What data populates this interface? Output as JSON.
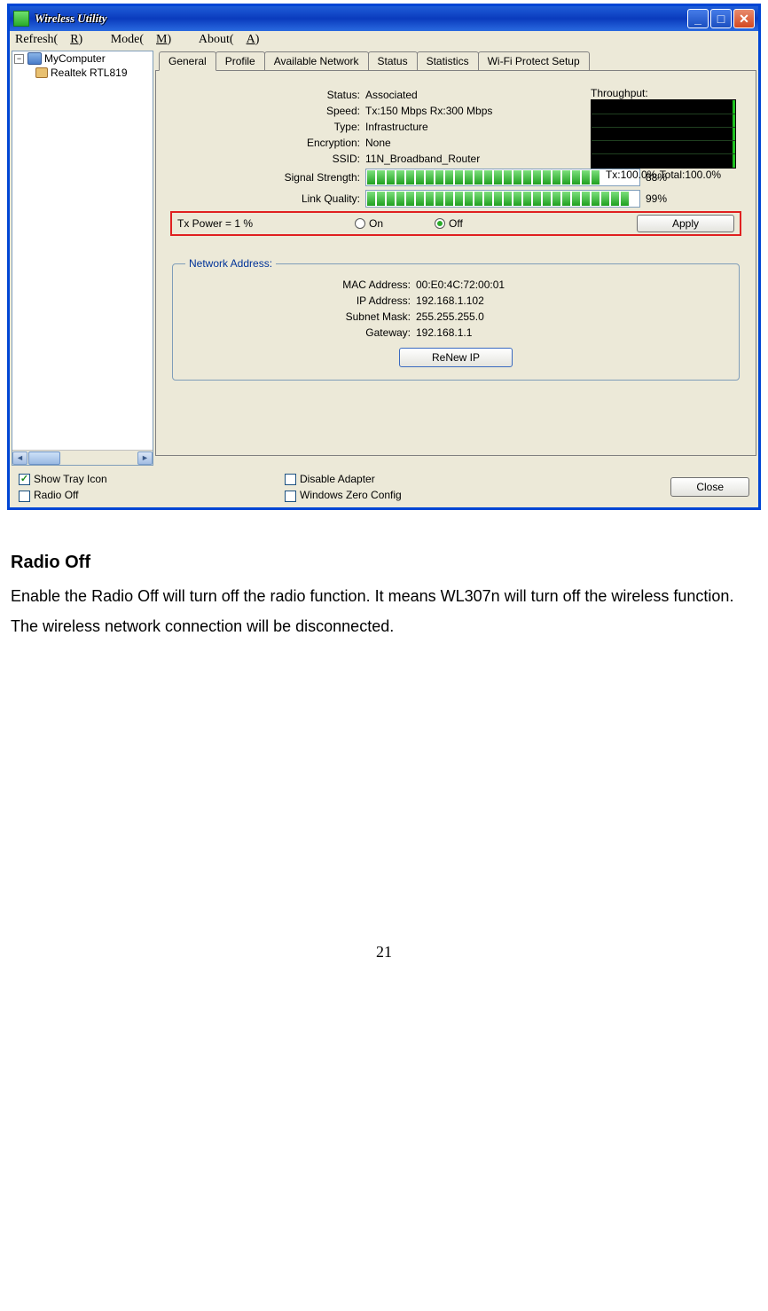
{
  "window": {
    "title": "Wireless Utility"
  },
  "menu": {
    "refresh": "Refresh(",
    "refresh_u": "R",
    "refresh_tail": ")",
    "mode": "Mode(",
    "mode_u": "M",
    "mode_tail": ")",
    "about": "About(",
    "about_u": "A",
    "about_tail": ")"
  },
  "tree": {
    "root": "MyComputer",
    "child": "Realtek RTL819"
  },
  "tabs": [
    "General",
    "Profile",
    "Available Network",
    "Status",
    "Statistics",
    "Wi-Fi Protect Setup"
  ],
  "general": {
    "status_label": "Status:",
    "status": "Associated",
    "speed_label": "Speed:",
    "speed": "Tx:150 Mbps Rx:300 Mbps",
    "type_label": "Type:",
    "type": "Infrastructure",
    "encryption_label": "Encryption:",
    "encryption": "None",
    "ssid_label": "SSID:",
    "ssid": "11N_Broadband_Router",
    "signal_label": "Signal Strength:",
    "signal_pct": "88%",
    "link_label": "Link Quality:",
    "link_pct": "99%"
  },
  "throughput": {
    "title": "Throughput:",
    "caption": "Tx:100.0%,Total:100.0%"
  },
  "txpower": {
    "label": "Tx Power =   1 %",
    "on": "On",
    "off": "Off",
    "apply": "Apply"
  },
  "netaddr": {
    "legend": "Network Address:",
    "mac_l": "MAC Address:",
    "mac": "00:E0:4C:72:00:01",
    "ip_l": "IP Address:",
    "ip": "192.168.1.102",
    "mask_l": "Subnet Mask:",
    "mask": "255.255.255.0",
    "gw_l": "Gateway:",
    "gw": "192.168.1.1",
    "renew": "ReNew IP"
  },
  "checks": {
    "tray": "Show Tray Icon",
    "radio": "Radio Off",
    "disable": "Disable Adapter",
    "wzc": "Windows Zero Config",
    "close": "Close"
  },
  "doc": {
    "heading": "Radio Off",
    "body": "Enable the Radio Off will turn off the radio function. It means WL307n will turn off the wireless function. The wireless network connection will be disconnected."
  },
  "page": "21"
}
